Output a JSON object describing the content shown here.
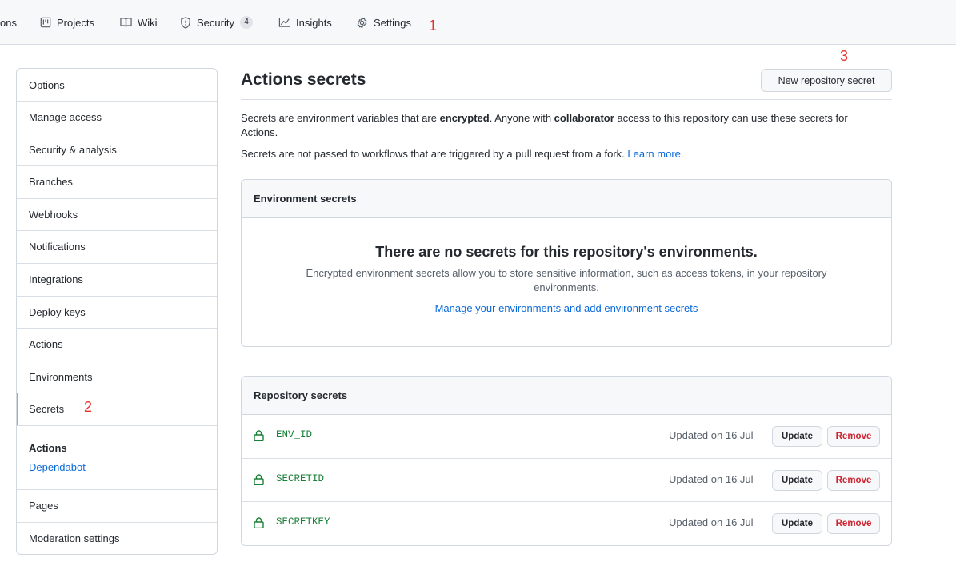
{
  "topnav": {
    "items": [
      {
        "label": "ons"
      },
      {
        "label": "Projects",
        "icon": "project-icon"
      },
      {
        "label": "Wiki",
        "icon": "book-icon"
      },
      {
        "label": "Security",
        "icon": "shield-icon",
        "count": "4"
      },
      {
        "label": "Insights",
        "icon": "graph-icon"
      },
      {
        "label": "Settings",
        "icon": "gear-icon"
      }
    ]
  },
  "annotations": [
    "1",
    "2",
    "3"
  ],
  "sidebar": {
    "items": [
      {
        "label": "Options"
      },
      {
        "label": "Manage access"
      },
      {
        "label": "Security & analysis"
      },
      {
        "label": "Branches"
      },
      {
        "label": "Webhooks"
      },
      {
        "label": "Notifications"
      },
      {
        "label": "Integrations"
      },
      {
        "label": "Deploy keys"
      },
      {
        "label": "Actions"
      },
      {
        "label": "Environments"
      },
      {
        "label": "Secrets",
        "selected": true
      }
    ],
    "group": {
      "title": "Actions",
      "link": "Dependabot"
    },
    "bottom_items": [
      {
        "label": "Pages"
      },
      {
        "label": "Moderation settings"
      }
    ]
  },
  "main": {
    "title": "Actions secrets",
    "new_button": "New repository secret",
    "para1": {
      "t1": "Secrets are environment variables that are ",
      "b1": "encrypted",
      "t2": ". Anyone with ",
      "b2": "collaborator",
      "t3": " access to this repository can use these secrets for Actions."
    },
    "para2": {
      "text": "Secrets are not passed to workflows that are triggered by a pull request from a fork. ",
      "link": "Learn more",
      "end": "."
    },
    "env_box": {
      "header": "Environment secrets",
      "blank_title": "There are no secrets for this repository's environments.",
      "blank_desc": "Encrypted environment secrets allow you to store sensitive information, such as access tokens, in your repository environments.",
      "blank_link": "Manage your environments and add environment secrets"
    },
    "repo_box": {
      "header": "Repository secrets",
      "update_label": "Update",
      "remove_label": "Remove",
      "secrets": [
        {
          "name": "ENV_ID",
          "updated": "Updated on 16 Jul"
        },
        {
          "name": "SECRETID",
          "updated": "Updated on 16 Jul"
        },
        {
          "name": "SECRETKEY",
          "updated": "Updated on 16 Jul"
        }
      ]
    }
  },
  "colors": {
    "accent_selected": "#fd8c73",
    "link": "#0969da",
    "secret_name": "#1a7f37",
    "danger": "#cf222e",
    "annotation": "#e5332a"
  }
}
